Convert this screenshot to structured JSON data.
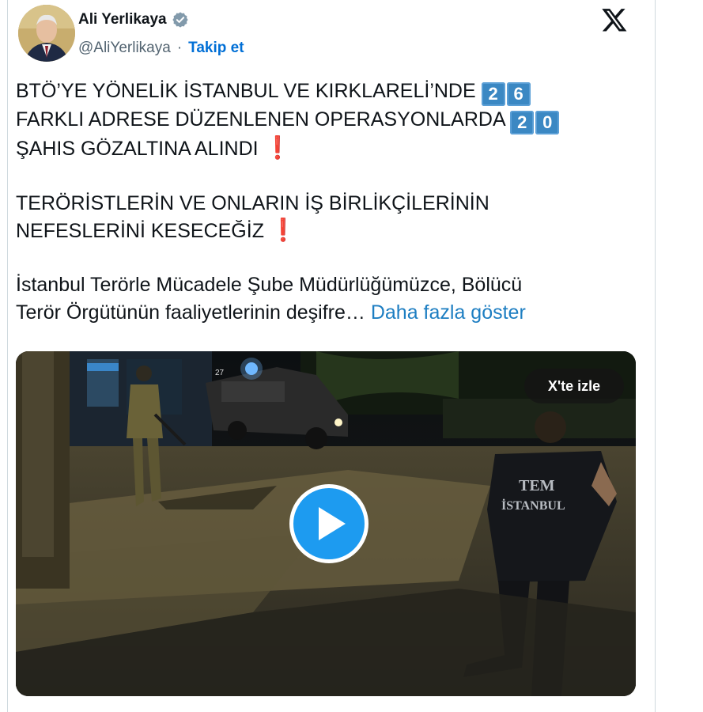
{
  "author": {
    "name": "Ali Yerlikaya",
    "handle": "@AliYerlikaya",
    "separator": "·",
    "follow_label": "Takip et"
  },
  "icons": {
    "verified": "verified-badge-icon",
    "platform": "x-logo-icon",
    "play": "play-icon"
  },
  "tweet": {
    "line1a": "BTÖ’YE YÖNELİK İSTANBUL VE KIRKLARELİ’NDE",
    "num1": [
      "2",
      "6"
    ],
    "line2a": "FARKLI ADRESE DÜZENLENEN OPERASYONLARDA",
    "num2": [
      "2",
      "0"
    ],
    "line3a": "ŞAHIS GÖZALTINA ALINDI",
    "excl": "❗",
    "line4": "TERÖRİSTLERİN VE ONLARIN İŞ BİRLİKÇİLERİNİN",
    "line5a": "NEFESLERİNİ KESECEĞİZ",
    "para2_line1": "İstanbul Terörle Mücadele Şube Müdürlüğümüzce, Bölücü",
    "para2_line2": "Terör Örgütünün faaliyetlerinin deşifre…",
    "show_more": "Daha fazla göster"
  },
  "media": {
    "watch_label": "X'te izle",
    "vest_text_1": "TEM",
    "vest_text_2": "İSTANBUL",
    "vehicle_number": "27"
  },
  "colors": {
    "link": "#1d9bf0",
    "follow": "#006fd6",
    "keycap": "#3b88c3",
    "exclamation": "#be1931",
    "verified": "#829aab"
  }
}
